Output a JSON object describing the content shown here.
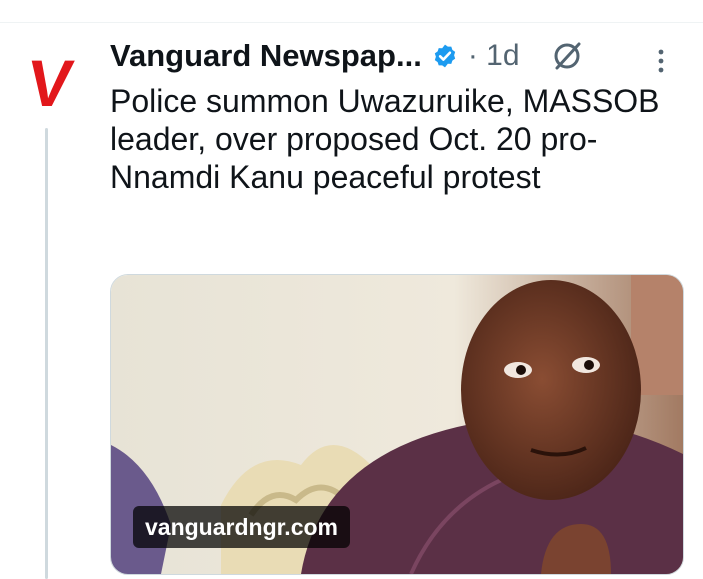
{
  "tweet": {
    "author_name": "Vanguard Newspap...",
    "meta": "· 1d",
    "text": "Police summon Uwazuruike, MASSOB leader, over proposed Oct. 20 pro-Nnamdi Kanu peaceful protest",
    "avatar_letter": "V",
    "link_domain": "vanguardngr.com"
  },
  "icons": {
    "verified": "verified-badge-icon",
    "grok": "grok-icon",
    "more": "more-vertical-icon"
  },
  "colors": {
    "brand_red": "#e2171b",
    "verified_blue": "#1d9bf0",
    "text_primary": "#0f1419",
    "text_secondary": "#536471",
    "thread_line": "#cfd9de"
  }
}
